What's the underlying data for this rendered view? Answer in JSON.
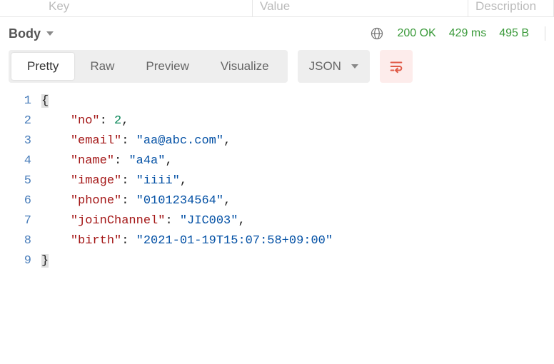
{
  "header": {
    "col_key": "Key",
    "col_value": "Value",
    "col_desc": "Description"
  },
  "section": {
    "label": "Body"
  },
  "status": {
    "code": "200 OK",
    "time": "429 ms",
    "size": "495 B"
  },
  "tabs": {
    "pretty": "Pretty",
    "raw": "Raw",
    "preview": "Preview",
    "visualize": "Visualize"
  },
  "format_select": {
    "value": "JSON"
  },
  "code": {
    "lines": [
      "1",
      "2",
      "3",
      "4",
      "5",
      "6",
      "7",
      "8",
      "9"
    ],
    "open_brace": "{",
    "close_brace": "}",
    "comma": ",",
    "colon": ":",
    "space": " ",
    "indent": "    ",
    "entries": {
      "no_key": "\"no\"",
      "no_val": "2",
      "email_key": "\"email\"",
      "email_val": "\"aa@abc.com\"",
      "name_key": "\"name\"",
      "name_val": "\"a4a\"",
      "image_key": "\"image\"",
      "image_val": "\"iiii\"",
      "phone_key": "\"phone\"",
      "phone_val": "\"0101234564\"",
      "join_key": "\"joinChannel\"",
      "join_val": "\"JIC003\"",
      "birth_key": "\"birth\"",
      "birth_val": "\"2021-01-19T15:07:58+09:00\""
    }
  }
}
